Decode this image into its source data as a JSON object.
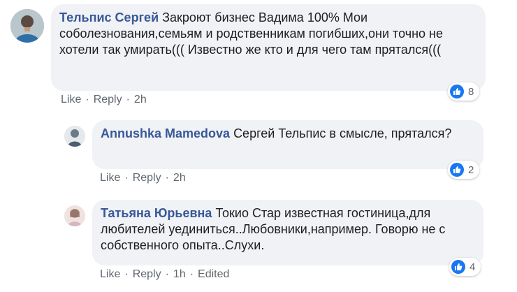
{
  "comments": [
    {
      "author": "Тельпис Сергей",
      "text": "Закроют бизнес Вадима 100% Мои соболезнования,семьям и родственникам погибших,они точно не хотели так умирать((( Известно же кто и для чего там прятался(((",
      "actions": {
        "like": "Like",
        "reply": "Reply",
        "time": "2h"
      },
      "reaction_count": "8"
    },
    {
      "author": "Annushka Mamedova",
      "text": "Сергей Тельпис в смысле, прятался?",
      "actions": {
        "like": "Like",
        "reply": "Reply",
        "time": "2h"
      },
      "reaction_count": "2"
    },
    {
      "author": "Татьяна Юрьевна",
      "text": "Токио Стар известная гостиница,для любителей уединиться..Любовники,например. Говорю не с собственного опыта..Слухи.",
      "actions": {
        "like": "Like",
        "reply": "Reply",
        "time": "1h",
        "edited": "Edited"
      },
      "reaction_count": "4"
    }
  ],
  "colors": {
    "author": "#385898",
    "bubble": "#f0f2f5",
    "like_blue": "#1877f2",
    "meta": "#65676b"
  }
}
